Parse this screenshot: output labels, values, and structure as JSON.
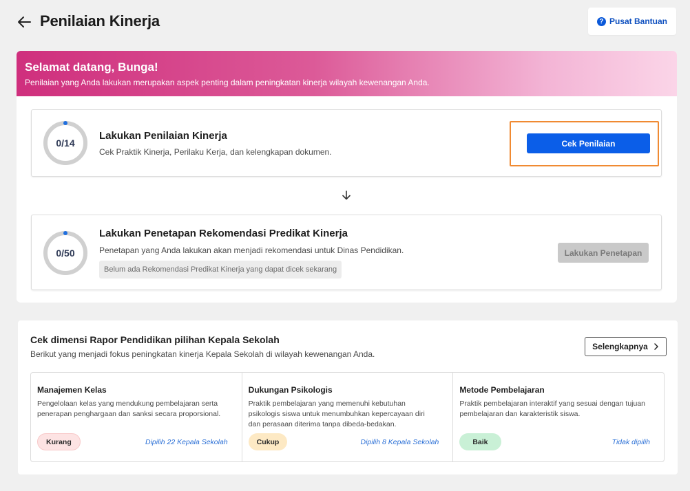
{
  "header": {
    "title": "Penilaian Kinerja",
    "help_label": "Pusat Bantuan",
    "help_icon_glyph": "?"
  },
  "banner": {
    "title": "Selamat datang, Bunga!",
    "subtitle": "Penilaian yang Anda lakukan merupakan aspek penting dalam peningkatan kinerja wilayah kewenangan Anda."
  },
  "tasks": [
    {
      "progress_label": "0/14",
      "progress_fraction": 0,
      "title": "Lakukan Penilaian Kinerja",
      "description": "Cek Praktik Kinerja, Perilaku Kerja, dan kelengkapan dokumen.",
      "button_label": "Cek Penilaian"
    },
    {
      "progress_label": "0/50",
      "progress_fraction": 0,
      "title": "Lakukan Penetapan Rekomendasi Predikat Kinerja",
      "description": "Penetapan yang Anda lakukan akan menjadi rekomendasi untuk Dinas Pendidikan.",
      "note": "Belum ada Rekomendasi Predikat Kinerja yang dapat dicek sekarang",
      "button_label": "Lakukan Penetapan"
    }
  ],
  "rapor": {
    "title": "Cek dimensi Rapor Pendidikan pilihan Kepala Sekolah",
    "subtitle": "Berikut yang menjadi fokus peningkatan kinerja Kepala Sekolah di wilayah kewenangan Anda.",
    "more_label": "Selengkapnya",
    "dimensions": [
      {
        "title": "Manajemen Kelas",
        "description": "Pengelolaan kelas yang mendukung pembelajaran serta penerapan penghargaan dan sanksi secara proporsional.",
        "badge": "Kurang",
        "link": "Dipilih 22 Kepala Sekolah"
      },
      {
        "title": "Dukungan Psikologis",
        "description": "Praktik pembelajaran yang memenuhi kebutuhan psikologis siswa untuk menumbuhkan kepercayaan diri dan perasaan diterima tanpa dibeda-bedakan.",
        "badge": "Cukup",
        "link": "Dipilih 8 Kepala Sekolah"
      },
      {
        "title": "Metode Pembelajaran",
        "description": "Praktik pembelajaran interaktif yang sesuai dengan tujuan pembelajaran dan karakteristik siswa.",
        "badge": "Baik",
        "link": "Tidak dipilih"
      }
    ]
  },
  "colors": {
    "primary": "#0b5ee8",
    "highlight": "#f08a32",
    "banner_start": "#cf2f7d",
    "banner_end": "#fbd5e8",
    "badge_kurang": "#fde3e3",
    "badge_cukup": "#fde9c4",
    "badge_baik": "#c9f0d6"
  },
  "icons": {
    "back": "arrow-left-icon",
    "help": "question-circle-icon",
    "down": "arrow-down-icon",
    "more": "chevron-right-icon"
  }
}
